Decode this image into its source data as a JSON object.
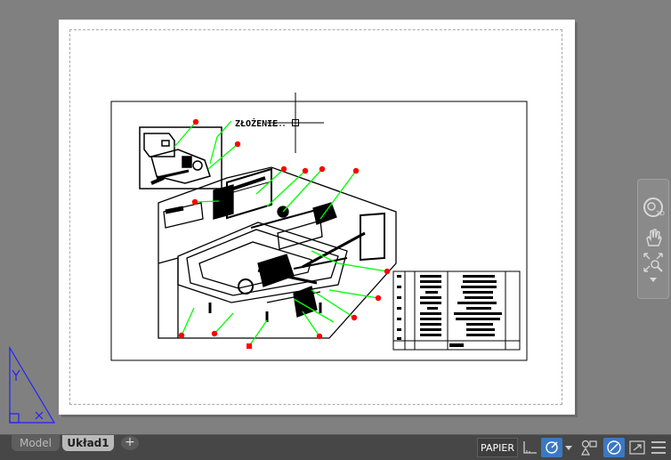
{
  "layout_tabs": [
    {
      "label": "Model",
      "active": false
    },
    {
      "label": "Układ1",
      "active": true
    }
  ],
  "add_tab_label": "+",
  "statusbar": {
    "space_label": "PAPIER",
    "icons": [
      "snap-icon",
      "ortho-grid-icon",
      "polar-dropdown-icon",
      "annotation-monitor-icon",
      "isolate-objects-icon",
      "fullscreen-icon",
      "menu-icon"
    ]
  },
  "navbar": {
    "tools": [
      "steering-wheel-2d-icon",
      "pan-hand-icon",
      "zoom-extents-icon"
    ]
  },
  "drawing": {
    "title_text": "ZŁOŻENIE",
    "callout_color": "#00ff00",
    "marker_color": "#ff0000",
    "ucs_color": "#2020ff"
  },
  "colors": {
    "canvas": "#808080",
    "paper": "#ffffff",
    "statusbar": "#474747",
    "accent": "#3b78c2"
  }
}
